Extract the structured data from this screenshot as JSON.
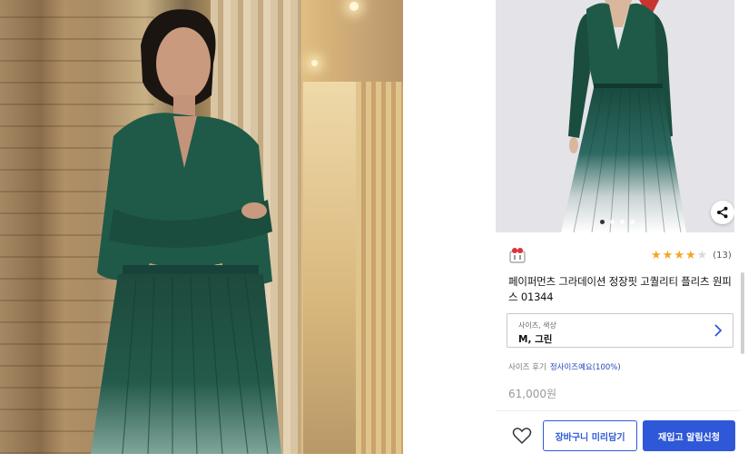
{
  "left_photo": {
    "icon": "drama-scene-photo"
  },
  "product": {
    "image_icon": "dress-product-photo",
    "carousel": {
      "count": 4,
      "active": 0
    },
    "brand_logo_icon": "brand-logo-icon",
    "rating": {
      "stars": 4.5,
      "review_count": "(13)"
    },
    "title": "페이퍼먼츠 그라데이션 정장핏 고퀄리티 플리츠 원피스 01344",
    "option": {
      "label": "사이즈, 색상",
      "value": "M, 그린"
    },
    "size_review": {
      "label": "사이즈 후기",
      "value": "정사이즈예요(100%)"
    },
    "price": "61,000원",
    "buttons": {
      "cart": "장바구니 미리담기",
      "restock": "재입고 알림신청"
    }
  },
  "colors": {
    "accent": "#2f58d8",
    "star": "#f5a623",
    "dress_green": "#1f5a48"
  }
}
